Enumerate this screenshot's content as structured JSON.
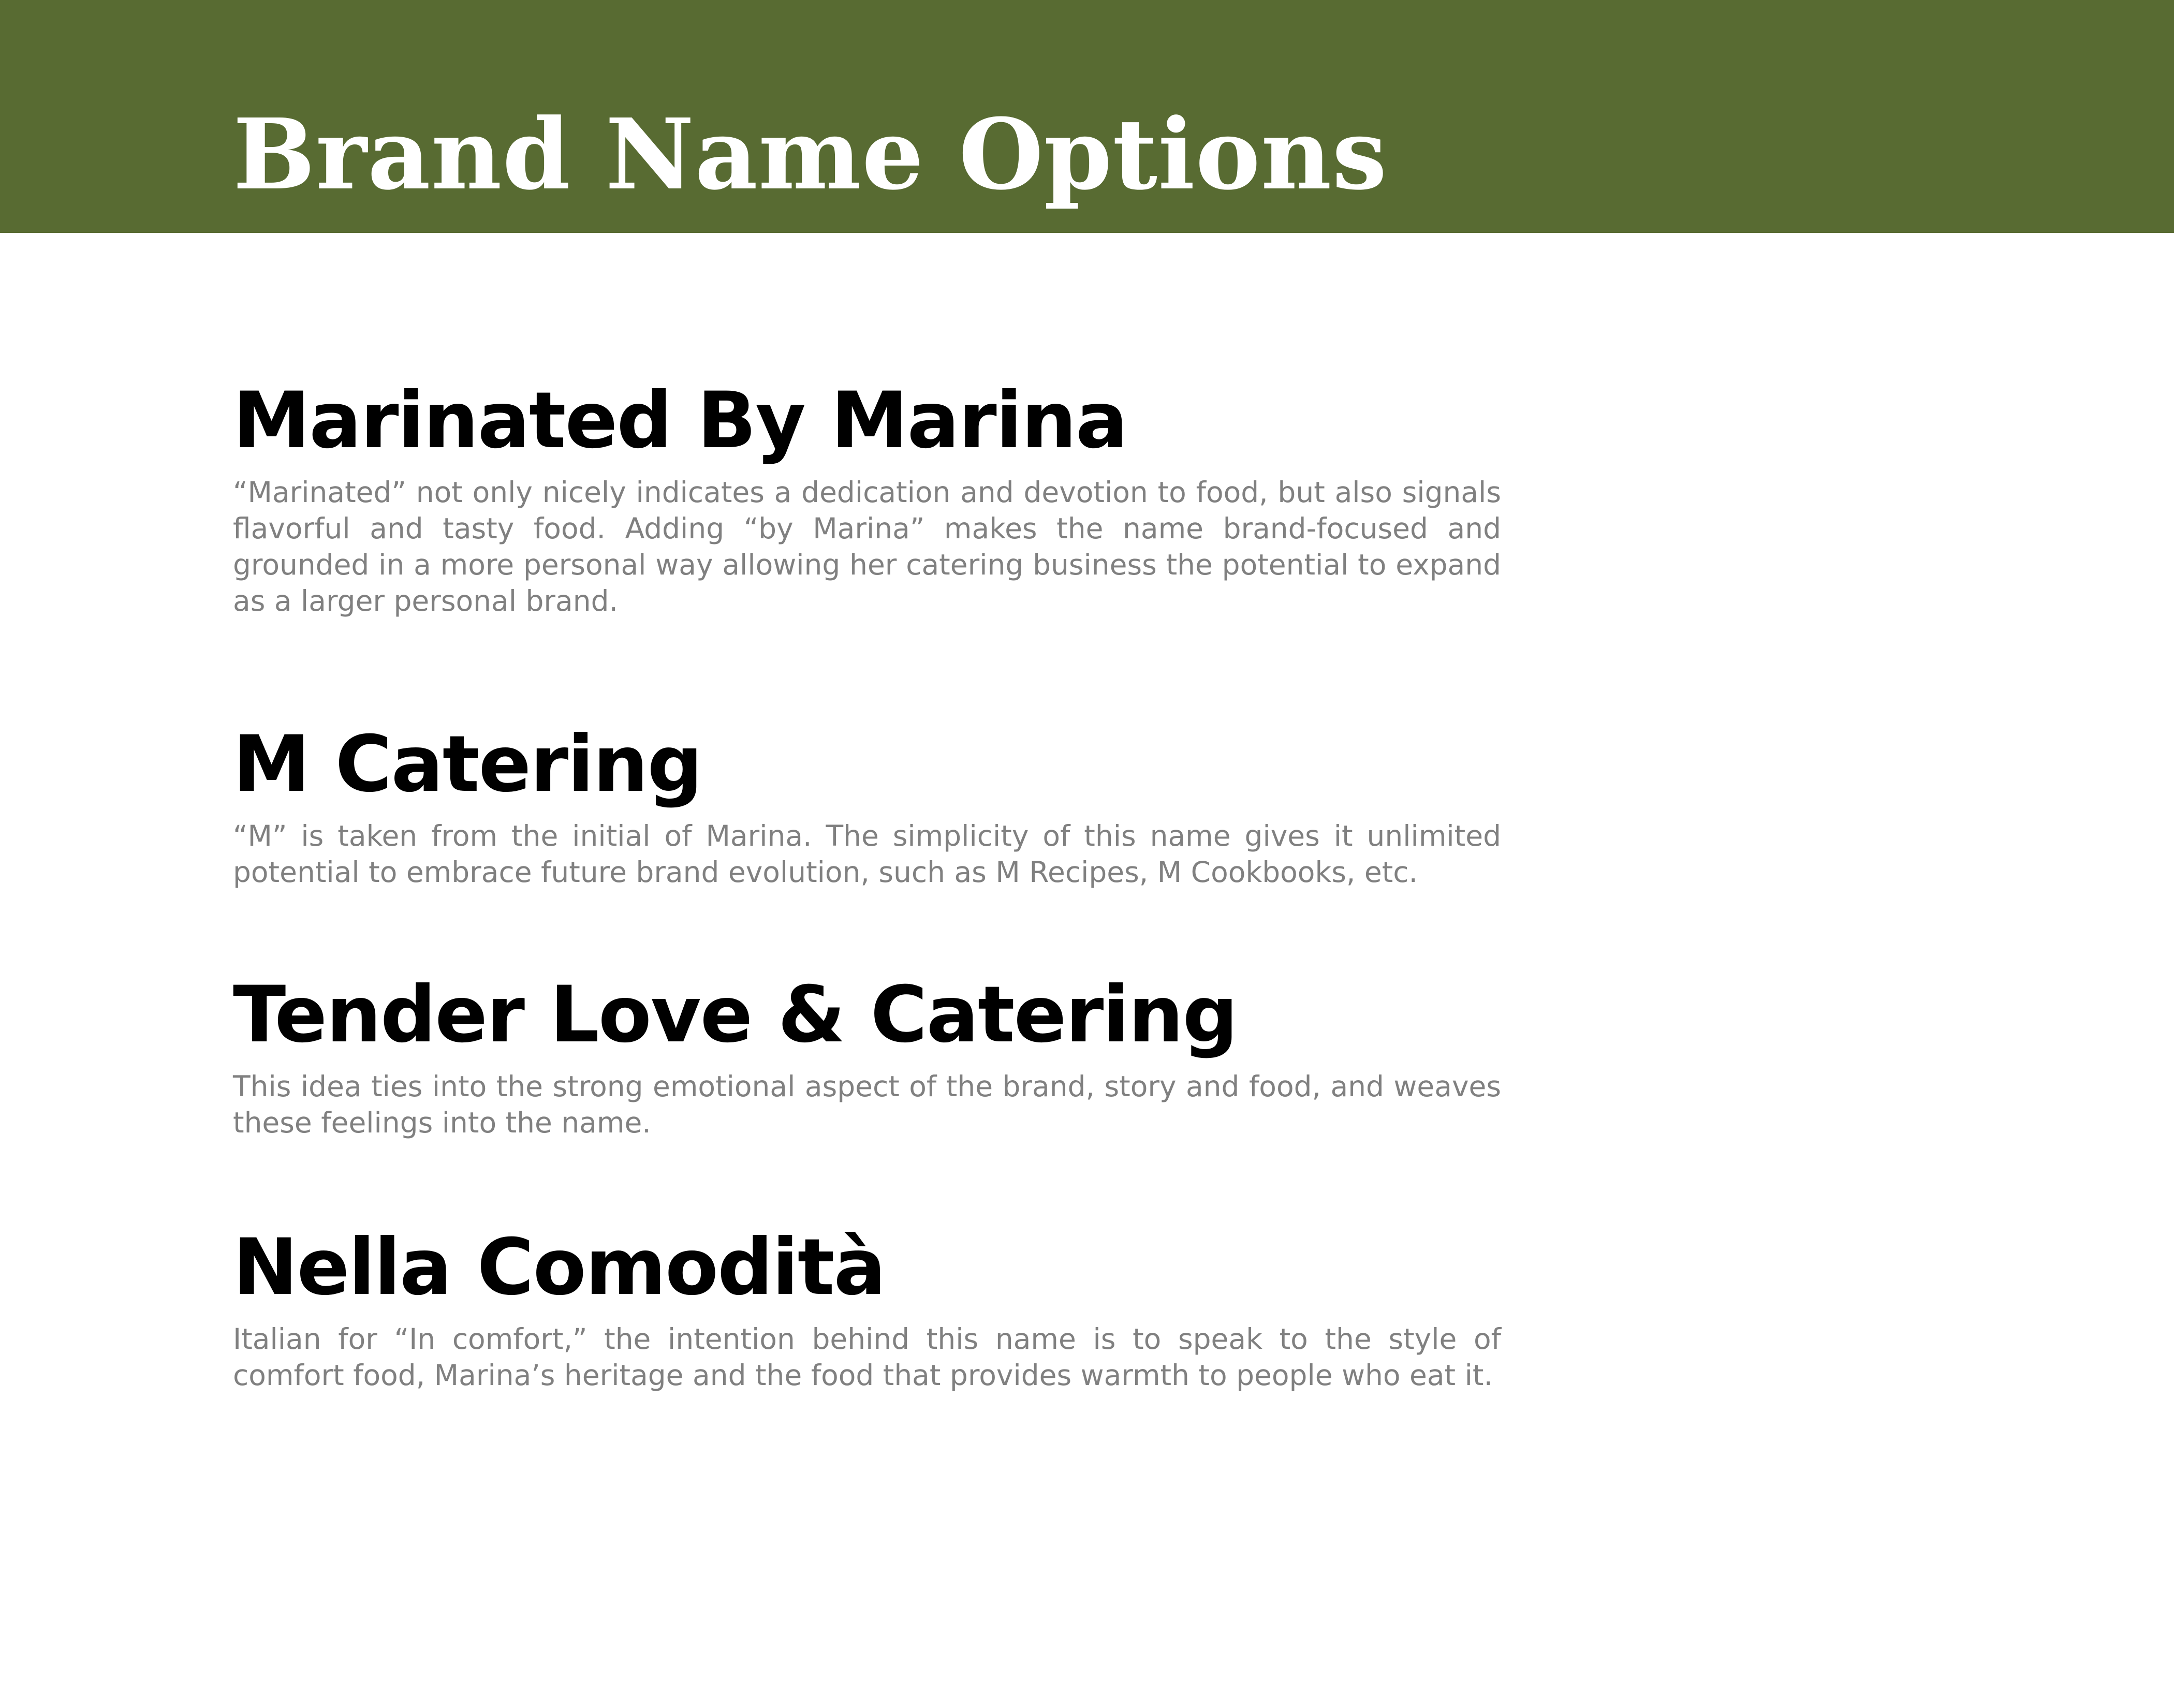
{
  "header": {
    "title": "Brand Name Options",
    "background_color": "#586b32"
  },
  "options": [
    {
      "name": "Marinated By Marina",
      "description": "“Marinated” not only nicely indicates a dedication and devotion to food, but also signals flavorful and tasty food. Adding “by Marina” makes the name brand-focused and grounded in a more personal way allowing her catering business the potential to expand as a larger personal brand."
    },
    {
      "name": "M Catering",
      "description": "“M” is taken from the initial of Marina. The simplicity of this name gives it unlimited potential to embrace future brand evolution, such as M Recipes, M Cookbooks, etc."
    },
    {
      "name": "Tender Love & Catering",
      "description": "This idea ties into the strong emotional aspect of the brand, story and food, and weaves these feelings into the name."
    },
    {
      "name": "Nella Comodità",
      "description": "Italian for “In comfort,” the intention behind this name is to speak to the style of comfort food, Marina’s heritage and the food that provides warmth to people who eat it."
    }
  ]
}
